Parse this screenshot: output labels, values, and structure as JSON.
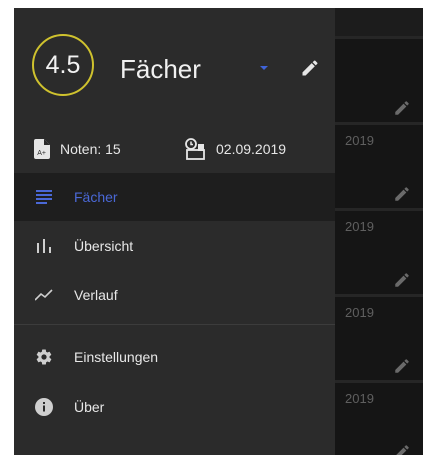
{
  "drawer": {
    "grade": "4.5",
    "title": "Fächer",
    "grades_count": "Noten: 15",
    "date": "02.09.2019",
    "nav": [
      {
        "label": "Fächer",
        "icon": "list-icon",
        "active": true
      },
      {
        "label": "Übersicht",
        "icon": "bar-chart-icon",
        "active": false
      },
      {
        "label": "Verlauf",
        "icon": "trend-icon",
        "active": false
      }
    ],
    "settings": [
      {
        "label": "Einstellungen",
        "icon": "gear-icon"
      },
      {
        "label": "Über",
        "icon": "info-icon"
      }
    ]
  },
  "background": {
    "card_dates": [
      "2019",
      "2019",
      "2019",
      "2019"
    ]
  },
  "colors": {
    "drawer_bg": "#2b2b2b",
    "active_bg": "#1e1e1e",
    "accent": "#4a68d6",
    "grade_ring": "#cfc22e"
  }
}
